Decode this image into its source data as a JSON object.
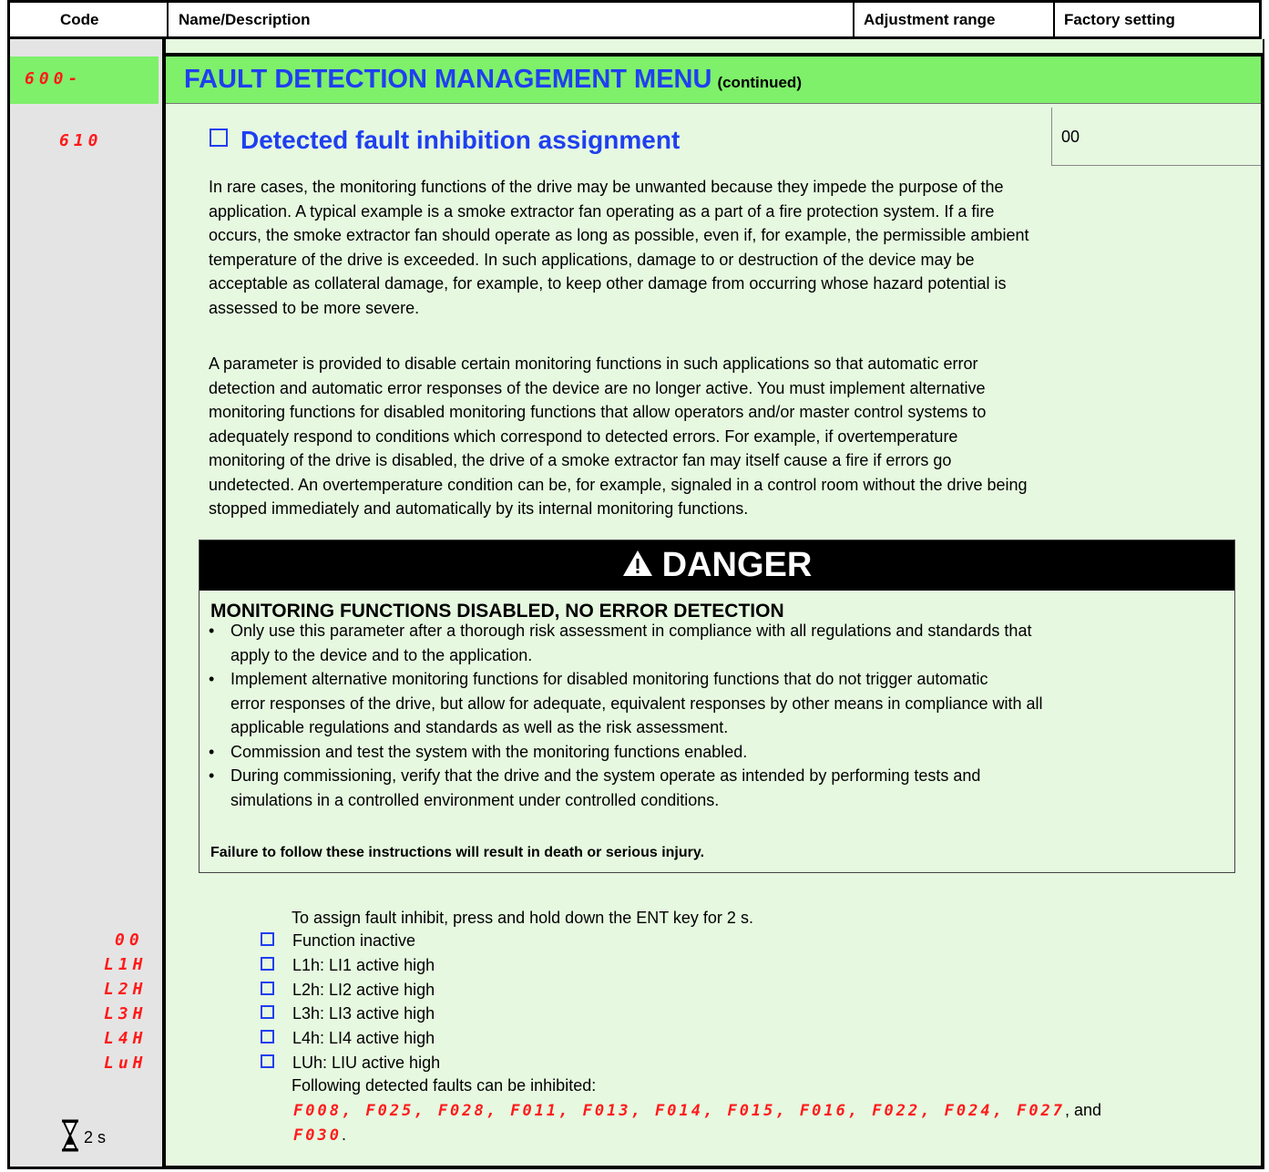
{
  "header": {
    "code": "Code",
    "name": "Name/Description",
    "adjustment": "Adjustment range",
    "factory": "Factory setting"
  },
  "menu": {
    "code": "600-",
    "title": "FAULT DETECTION MANAGEMENT MENU",
    "continued": "(continued)"
  },
  "parameter": {
    "code": "610",
    "title": "Detected fault inhibition assignment",
    "factory_value": "00"
  },
  "paragraphs": {
    "p1": [
      "In rare cases, the monitoring functions of the drive may be unwanted because they impede the purpose of the",
      "application. A typical example is a smoke extractor fan operating as a part of a fire protection system. If a fire",
      "occurs, the smoke extractor fan should operate as long as possible, even if, for example, the permissible ambient",
      "temperature of the drive is exceeded. In such applications, damage to or destruction of the device may be",
      "acceptable as collateral damage, for example, to keep other damage from occurring whose hazard potential is",
      "assessed to be more severe."
    ],
    "p2": [
      "A parameter is provided to disable certain monitoring functions in such applications so that automatic error",
      "detection and automatic error responses of the device are no longer active. You must implement alternative",
      "monitoring functions for disabled monitoring functions that allow operators and/or master control systems to",
      "adequately respond to conditions which correspond to detected errors. For example, if overtemperature",
      "monitoring of the drive is disabled, the drive of a smoke extractor fan may itself cause a fire if errors go",
      "undetected. An overtemperature condition can be, for example, signaled in a control room without the drive being",
      "stopped immediately and automatically by its internal monitoring functions."
    ]
  },
  "danger": {
    "label": "DANGER",
    "title": "MONITORING FUNCTIONS DISABLED, NO ERROR DETECTION",
    "bullets": [
      [
        "Only use this parameter after a thorough risk assessment in compliance with all regulations and standards that",
        "apply to the device and to the application."
      ],
      [
        "Implement alternative monitoring functions for disabled monitoring functions that do not trigger automatic",
        "error responses of the drive, but allow for adequate, equivalent responses by other means in compliance with all",
        "applicable regulations and standards as well as the risk assessment."
      ],
      [
        "Commission and test the system with the monitoring functions enabled."
      ],
      [
        "During commissioning, verify that the drive and the system operate as intended by performing tests and",
        "simulations in a controlled environment under controlled conditions."
      ]
    ],
    "bullet_char": "•",
    "warning": "Failure to follow these instructions will result in death or serious injury."
  },
  "options": {
    "intro": "To assign fault inhibit, press and hold down the ENT key for 2 s.",
    "items": [
      {
        "code": "00",
        "label": "Function inactive"
      },
      {
        "code": "L1H",
        "label": "L1h: LI1 active high"
      },
      {
        "code": "L2H",
        "label": "L2h: LI2 active high"
      },
      {
        "code": "L3H",
        "label": "L3h: LI3 active high"
      },
      {
        "code": "L4H",
        "label": "L4h: LI4 active high"
      },
      {
        "code": "LuH",
        "label": "LUh: LIU active high"
      }
    ],
    "following": "Following detected faults can be inhibited:",
    "fault_codes_line1": "F008, F025, F028, F011, F013, F014, F015, F016, F022, F024, F027",
    "and": ", and",
    "fault_codes_line2": "F030",
    "period": "."
  },
  "hold": {
    "icon": "hourglass-icon",
    "time": "2 s"
  },
  "colors": {
    "green_band": "#7ef06a",
    "body_green": "#e6f8e0",
    "code_gray": "#e4e4e4",
    "title_blue": "#1f3ff0",
    "code_red": "#ff1a1a"
  }
}
